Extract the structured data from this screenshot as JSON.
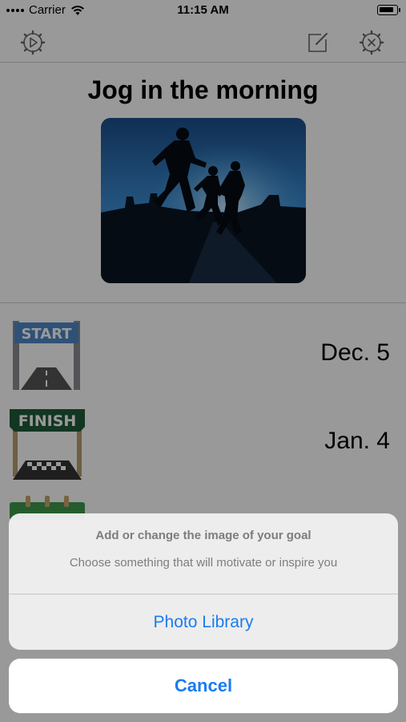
{
  "status_bar": {
    "carrier": "Carrier",
    "time": "11:15 AM"
  },
  "nav": {
    "left_icon": "play-gear-icon",
    "edit_icon": "edit-icon",
    "delete_icon": "delete-gear-icon"
  },
  "goal": {
    "title": "Jog in the morning",
    "image": "runners-silhouette-photo"
  },
  "rows": [
    {
      "sign_label": "START",
      "date": "Dec. 5"
    },
    {
      "sign_label": "FINISH",
      "date": "Jan. 4"
    }
  ],
  "action_sheet": {
    "title": "Add or change the image of your goal",
    "message": "Choose something that will motivate or inspire you",
    "options": [
      "Photo Library"
    ],
    "cancel_label": "Cancel",
    "accent": "#1a7cf0"
  }
}
